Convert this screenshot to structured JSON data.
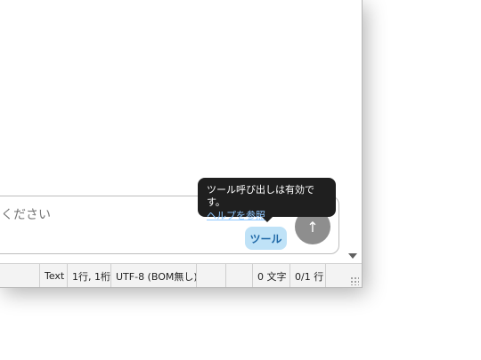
{
  "chat": {
    "input_placeholder": "ください",
    "tools_label": "ツール",
    "send_icon": "↑"
  },
  "tooltip": {
    "message": "ツール呼び出しは有効です。",
    "link": "ヘルプを参照"
  },
  "statusbar": {
    "language": "Text",
    "position": "1行, 1桁",
    "encoding": "UTF-8 (BOM無し)",
    "char_count": "0 文字",
    "line_count": "0/1 行"
  }
}
